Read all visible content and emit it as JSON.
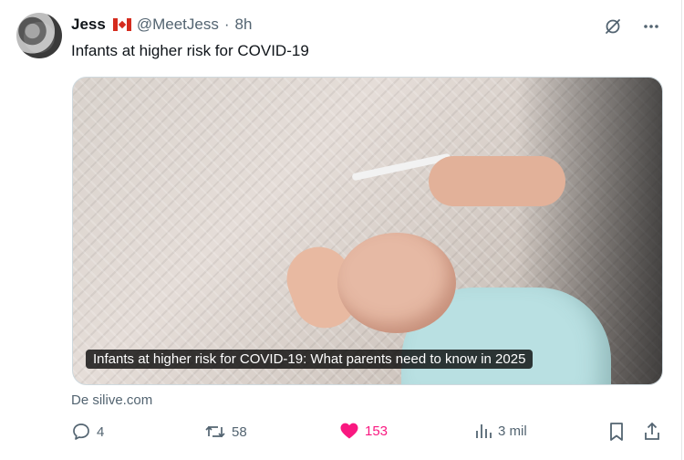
{
  "post": {
    "author": {
      "name": "Jess",
      "handle": "@MeetJess",
      "separator": "·",
      "time": "8h",
      "flag_icon": "canada-flag-icon"
    },
    "text": "Infants at higher risk for COVID-19",
    "media": {
      "caption": "Infants at higher risk for COVID-19: What parents need to know in 2025"
    },
    "source": "De silive.com",
    "top_actions": [
      "grok-icon",
      "more-icon"
    ],
    "stats": {
      "replies": "4",
      "reposts": "58",
      "likes": "153",
      "views": "3 mil"
    },
    "colors": {
      "text_primary": "#0f1419",
      "text_secondary": "#536471",
      "like_active": "#f91880"
    }
  }
}
